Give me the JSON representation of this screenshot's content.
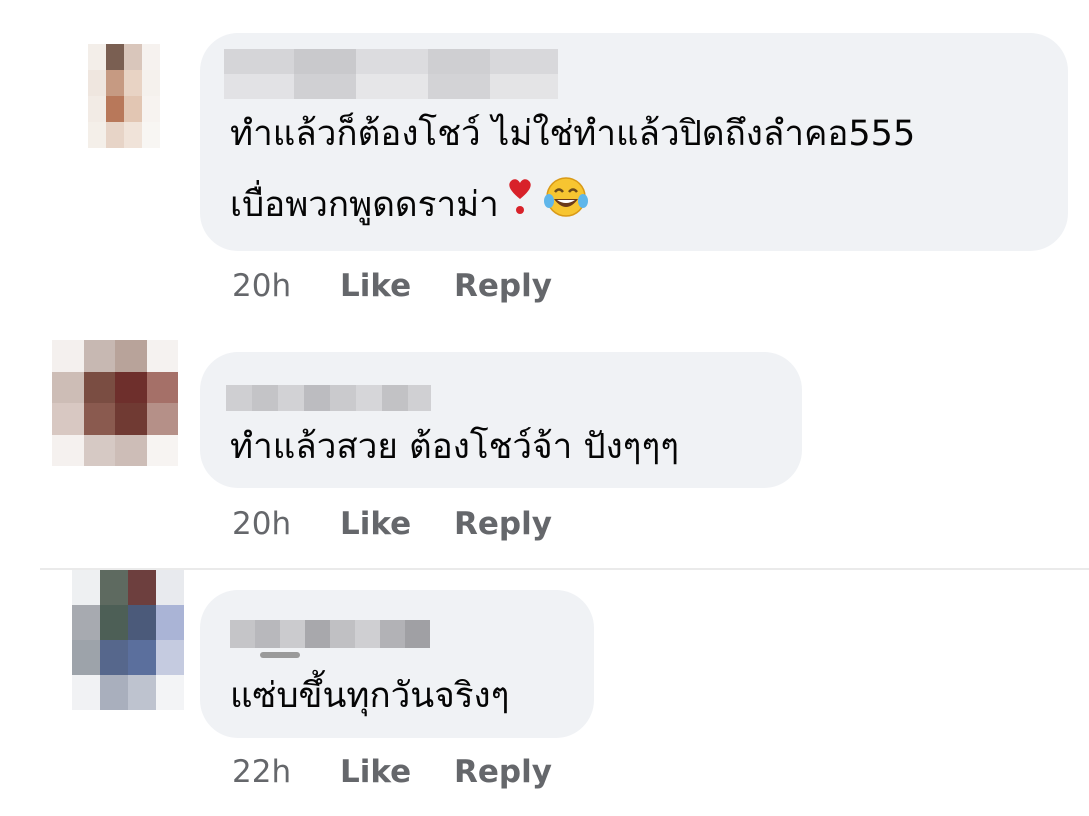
{
  "comments": [
    {
      "text_line1": "ทำแล้วก็ต้องโชว์ ไม่ใช่ทำแล้วปิดถึงลำคอ555",
      "text_line2": "เบื่อพวกพูดดราม่า",
      "emojis": [
        "heavy-heart-exclamation-icon",
        "tears-of-joy-icon"
      ],
      "time": "20h",
      "like_label": "Like",
      "reply_label": "Reply"
    },
    {
      "text_line1": "ทำแล้วสวย ต้องโชว์จ้า ปังๆๆๆ",
      "time": "20h",
      "like_label": "Like",
      "reply_label": "Reply"
    },
    {
      "text_line1": "แซ่บขึ้นทุกวันจริงๆ",
      "time": "22h",
      "like_label": "Like",
      "reply_label": "Reply"
    }
  ],
  "colors": {
    "bubble": "#f0f2f5",
    "text": "#050505",
    "meta": "#65676b",
    "heart": "#d8222a",
    "emoji_face": "#f7c531"
  }
}
